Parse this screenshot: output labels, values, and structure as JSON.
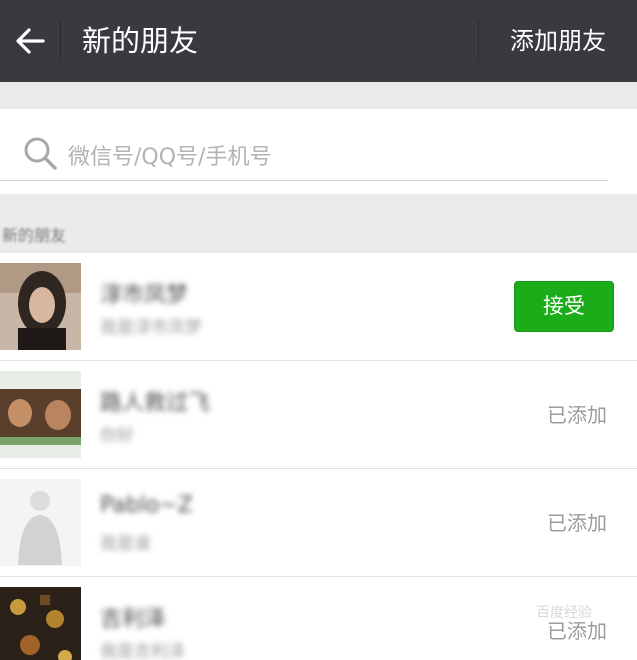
{
  "header": {
    "title": "新的朋友",
    "add_friend_label": "添加朋友"
  },
  "search": {
    "placeholder": "微信号/QQ号/手机号"
  },
  "section": {
    "label": "新的朋友"
  },
  "requests": [
    {
      "name": "淳市凤梦",
      "subtitle": "我是淳市凤梦",
      "status": "接受",
      "status_type": "accept"
    },
    {
      "name": "路人救过飞",
      "subtitle": "你好",
      "status": "已添加",
      "status_type": "added"
    },
    {
      "name": "Pablo~Z",
      "subtitle": "我是谁",
      "status": "已添加",
      "status_type": "added"
    },
    {
      "name": "吉利泽",
      "subtitle": "我是吉利泽",
      "status": "已添加",
      "status_type": "added"
    }
  ],
  "colors": {
    "topbar": "#393a3f",
    "accent_green": "#1aad19",
    "background_gray": "#ebebeb"
  },
  "watermark": {
    "text": "百度经验"
  }
}
